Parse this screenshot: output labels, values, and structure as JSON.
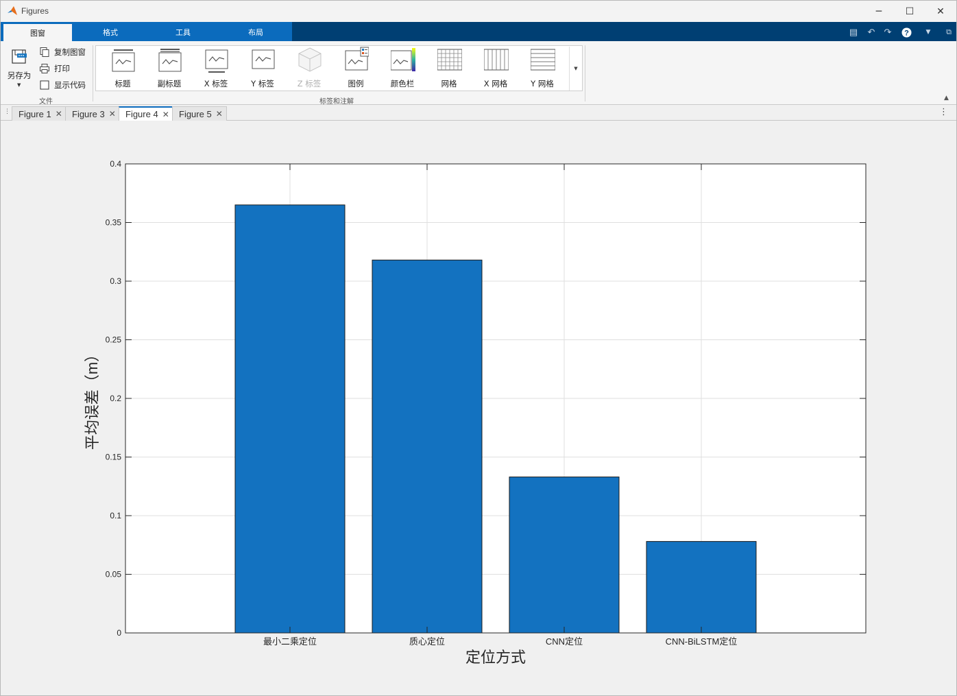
{
  "window": {
    "title": "Figures"
  },
  "ribbon_tabs": [
    {
      "label": "图窗",
      "active": true
    },
    {
      "label": "格式",
      "active": false
    },
    {
      "label": "工具",
      "active": false
    },
    {
      "label": "布局",
      "active": false
    }
  ],
  "file_group": {
    "save_as": "另存为",
    "copy_figure": "复制图窗",
    "print": "打印",
    "show_code": "显示代码",
    "label": "文件"
  },
  "annotation_group": {
    "label": "标签和注解",
    "tools": [
      {
        "label": "标题",
        "icon": "title-icon",
        "enabled": true
      },
      {
        "label": "副标题",
        "icon": "subtitle-icon",
        "enabled": true
      },
      {
        "label": "X 标签",
        "icon": "x-label-icon",
        "enabled": true
      },
      {
        "label": "Y 标签",
        "icon": "y-label-icon",
        "enabled": true
      },
      {
        "label": "Z 标签",
        "icon": "z-label-icon",
        "enabled": false
      },
      {
        "label": "图例",
        "icon": "legend-icon",
        "enabled": true
      },
      {
        "label": "颜色栏",
        "icon": "colorbar-icon",
        "enabled": true
      },
      {
        "label": "网格",
        "icon": "grid-icon",
        "enabled": true
      },
      {
        "label": "X 网格",
        "icon": "x-grid-icon",
        "enabled": true
      },
      {
        "label": "Y 网格",
        "icon": "y-grid-icon",
        "enabled": true
      }
    ]
  },
  "document_tabs": [
    {
      "label": "Figure 1",
      "active": false
    },
    {
      "label": "Figure 3",
      "active": false
    },
    {
      "label": "Figure 4",
      "active": true
    },
    {
      "label": "Figure 5",
      "active": false
    }
  ],
  "colors": {
    "bar": "#1372c0",
    "tab_strip": "#003f73",
    "tab_blue": "#0b6bbd"
  },
  "chart_data": {
    "type": "bar",
    "categories": [
      "最小二乘定位",
      "质心定位",
      "CNN定位",
      "CNN-BiLSTM定位"
    ],
    "values": [
      0.365,
      0.318,
      0.133,
      0.078
    ],
    "xlabel": "定位方式",
    "ylabel": "平均误差（m）",
    "ylim": [
      0,
      0.4
    ],
    "yticks": [
      "0",
      "0.05",
      "0.1",
      "0.15",
      "0.2",
      "0.25",
      "0.3",
      "0.35",
      "0.4"
    ],
    "grid": true
  }
}
